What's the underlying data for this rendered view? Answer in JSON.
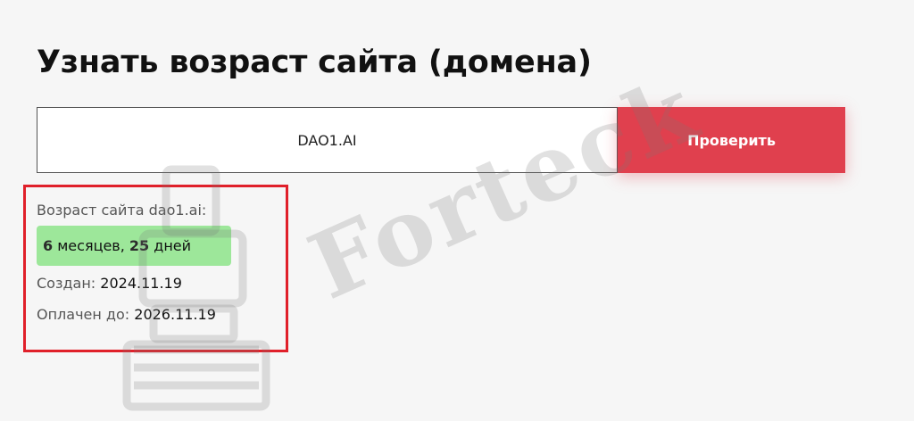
{
  "header": {
    "title": "Узнать возраст сайта (домена)"
  },
  "search": {
    "value": "DAO1.AI",
    "button_label": "Проверить"
  },
  "result": {
    "label": "Возраст сайта dao1.ai:",
    "months_value": "6",
    "months_unit": " месяцев, ",
    "days_value": "25",
    "days_unit": " дней",
    "created_label": "Создан: ",
    "created_value": "2024.11.19",
    "paid_label": "Оплачен до: ",
    "paid_value": "2026.11.19"
  },
  "watermark": {
    "text": "Forteck",
    "icon": "printer-icon"
  },
  "colors": {
    "accent": "#e0404e",
    "highlight_border": "#e0202a",
    "badge_background": "#9de79a"
  }
}
